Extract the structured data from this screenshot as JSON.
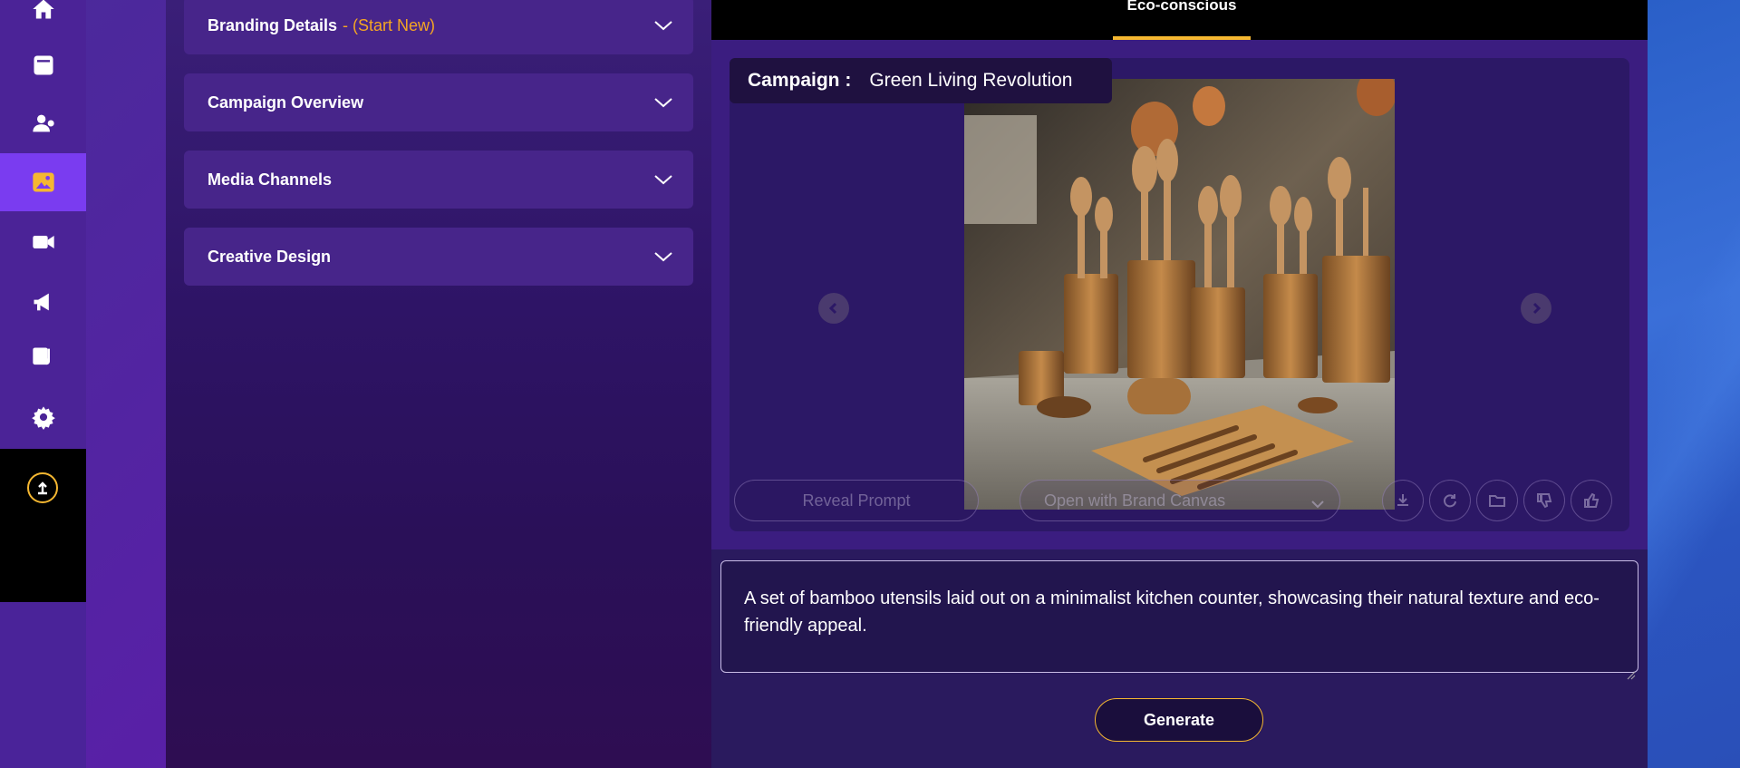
{
  "sidebar": {
    "items": [
      {
        "icon": "home-icon"
      },
      {
        "icon": "archive-icon"
      },
      {
        "icon": "user-gear-icon"
      },
      {
        "icon": "image-icon",
        "active": true
      },
      {
        "icon": "video-icon"
      },
      {
        "icon": "megaphone-icon"
      },
      {
        "icon": "music-note-icon"
      },
      {
        "icon": "gear-icon"
      }
    ],
    "upload_icon": "upload-icon"
  },
  "accordions": [
    {
      "label": "Branding Details",
      "sub": "- (Start New)"
    },
    {
      "label": "Campaign Overview"
    },
    {
      "label": "Media Channels"
    },
    {
      "label": "Creative Design"
    }
  ],
  "tabs": {
    "active_label": "Eco-conscious"
  },
  "campaign": {
    "key": "Campaign :",
    "name": "Green Living Revolution"
  },
  "actions": {
    "reveal_prompt": "Reveal Prompt",
    "open_with": "Open with Brand Canvas",
    "icons": [
      "download-icon",
      "refresh-icon",
      "folder-icon",
      "thumbs-down-icon",
      "thumbs-up-icon"
    ]
  },
  "prompt": {
    "text": "A set of bamboo utensils laid out on a minimalist kitchen counter, showcasing their natural texture and eco-friendly appeal."
  },
  "generate_label": "Generate",
  "colors": {
    "accent": "#f5b731",
    "active_nav": "#7a3cf0",
    "subtitle": "#f5a623"
  }
}
